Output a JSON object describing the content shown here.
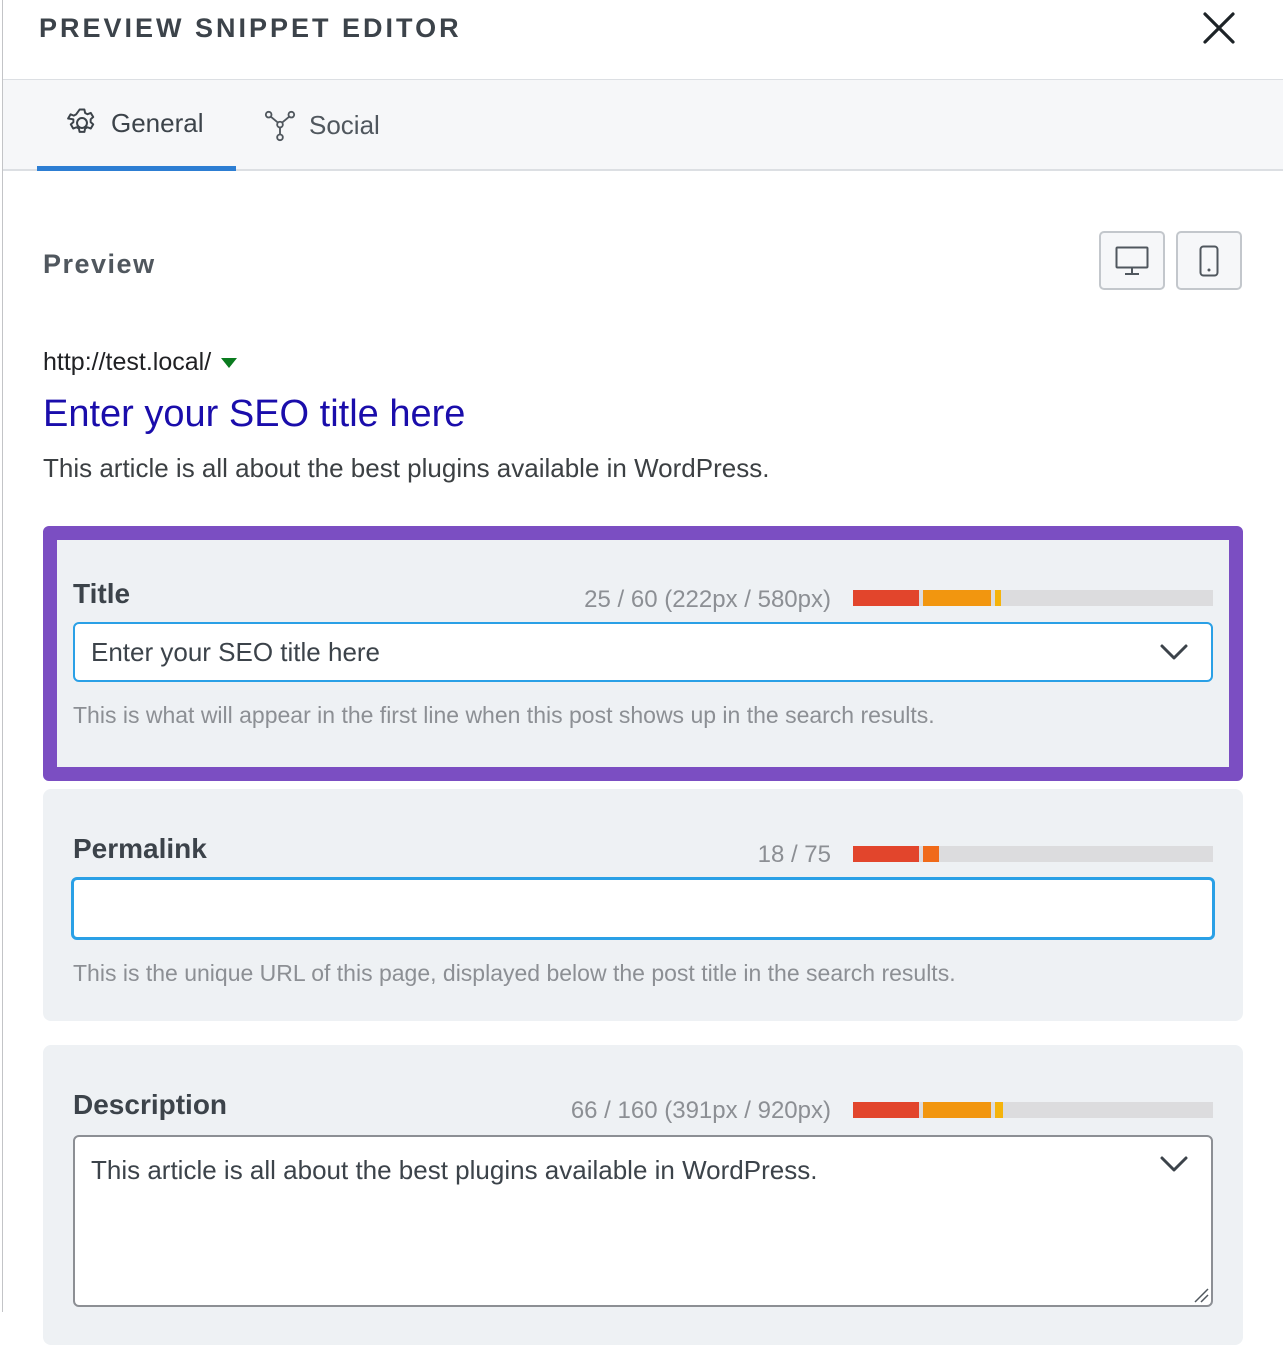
{
  "header": {
    "title": "PREVIEW SNIPPET EDITOR"
  },
  "tabs": [
    {
      "label": "General",
      "icon": "gear-icon",
      "active": true
    },
    {
      "label": "Social",
      "icon": "share-nodes-icon",
      "active": false
    }
  ],
  "preview": {
    "label": "Preview",
    "url": "http://test.local/",
    "seo_title": "Enter your SEO title here",
    "description": "This article is all about the best plugins available in WordPress."
  },
  "fields": {
    "title": {
      "label": "Title",
      "counter": "25 / 60 (222px / 580px)",
      "value": "Enter your SEO title here",
      "help": "This is what will appear in the first line when this post shows up in the search results.",
      "length_fraction": 0.41
    },
    "permalink": {
      "label": "Permalink",
      "counter": "18 / 75",
      "value": "",
      "help": "This is the unique URL of this page, displayed below the post title in the search results.",
      "length_fraction": 0.24
    },
    "description": {
      "label": "Description",
      "counter": "66 / 160 (391px / 920px)",
      "value": "This article is all about the best plugins available in WordPress.",
      "length_fraction": 0.42
    }
  },
  "colors": {
    "highlight": "#7b4ec2",
    "tab_active": "#2d7ed3",
    "input_focus": "#2aa0e6",
    "serp_title": "#1a0dab",
    "serp_url_arrow": "#0a7b1f",
    "bar_red": "#e2452c",
    "bar_orange": "#f2960f",
    "bar_yellow": "#f5b30b"
  }
}
